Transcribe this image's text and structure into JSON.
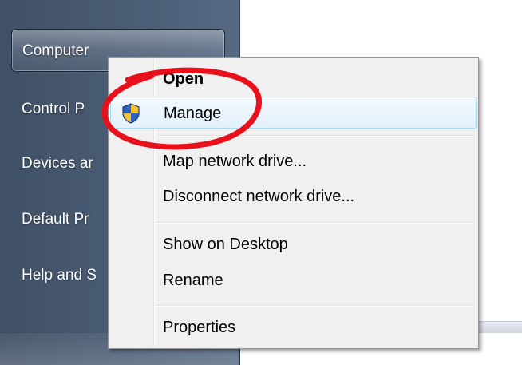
{
  "start_menu": {
    "items": [
      {
        "label": "Computer",
        "selected": true
      },
      {
        "label": "Control P"
      },
      {
        "label": "Devices ar"
      },
      {
        "label": "Default Pr"
      },
      {
        "label": "Help and S"
      }
    ]
  },
  "context_menu": {
    "items": [
      {
        "label": "Open",
        "bold": true
      },
      {
        "label": "Manage",
        "icon": "uac-shield-icon",
        "highlighted": true
      },
      {
        "label": "Map network drive..."
      },
      {
        "label": "Disconnect network drive..."
      },
      {
        "label": "Show on Desktop"
      },
      {
        "label": "Rename"
      },
      {
        "label": "Properties"
      }
    ]
  },
  "colors": {
    "annotation": "#e8101a",
    "hover_border": "#a8d8f8",
    "panel": "#4b5d75"
  }
}
